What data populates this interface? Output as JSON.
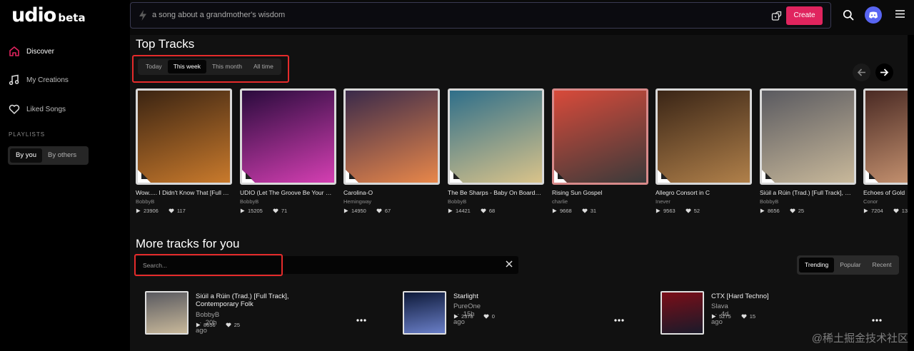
{
  "logo": {
    "main": "udio",
    "badge": "beta"
  },
  "sidebar": {
    "items": [
      {
        "label": "Discover",
        "icon": "home-icon",
        "active": true
      },
      {
        "label": "My Creations",
        "icon": "music-note-icon",
        "active": false
      },
      {
        "label": "Liked Songs",
        "icon": "heart-icon",
        "active": false
      }
    ],
    "playlists_label": "PLAYLISTS",
    "playlist_tabs": [
      {
        "label": "By you",
        "active": true
      },
      {
        "label": "By others",
        "active": false
      }
    ]
  },
  "topbar": {
    "prompt_placeholder": "a song about a grandmother's wisdom",
    "create_label": "Create",
    "icons": [
      "bolt-icon",
      "dice-icon",
      "search-icon",
      "discord-icon",
      "menu-icon"
    ]
  },
  "top_tracks": {
    "title": "Top Tracks",
    "tabs": [
      {
        "label": "Today",
        "active": false
      },
      {
        "label": "This week",
        "active": true
      },
      {
        "label": "This month",
        "active": false
      },
      {
        "label": "All time",
        "active": false
      }
    ],
    "tracks": [
      {
        "title": "Wow..... I Didn't Know That [Full Track]",
        "artist": "BobbyB",
        "plays": "23906",
        "likes": "117",
        "cover": [
          "#3b2412",
          "#c97a2c"
        ]
      },
      {
        "title": "UDIO (Let The Groove Be Your Guide)",
        "artist": "BobbyB",
        "plays": "15205",
        "likes": "71",
        "cover": [
          "#2a0b3d",
          "#d43fb2"
        ]
      },
      {
        "title": "Carolina-O",
        "artist": "Hemingway",
        "plays": "14950",
        "likes": "67",
        "cover": [
          "#3a2a4a",
          "#e8874a"
        ]
      },
      {
        "title": "The Be Sharps - Baby On Board, The Simpsons",
        "artist": "BobbyB",
        "plays": "14421",
        "likes": "68",
        "cover": [
          "#2f6f8a",
          "#d9c38a"
        ]
      },
      {
        "title": "Rising Sun Gospel",
        "artist": "charlie",
        "plays": "9668",
        "likes": "31",
        "cover": [
          "#d84a3a",
          "#3a3a3a"
        ]
      },
      {
        "title": "Allegro Consort in C",
        "artist": "Inever",
        "plays": "9563",
        "likes": "52",
        "cover": [
          "#3a2516",
          "#b0804a"
        ]
      },
      {
        "title": "Siúil a Rúin (Trad.) [Full Track], Contemporary Folk",
        "artist": "BobbyB",
        "plays": "8656",
        "likes": "25",
        "cover": [
          "#5a5a60",
          "#c8b89a"
        ]
      },
      {
        "title": "Echoes of Gold",
        "artist": "Conor",
        "plays": "7204",
        "likes": "13",
        "cover": [
          "#4a2a24",
          "#d6a07a"
        ]
      }
    ]
  },
  "more_tracks": {
    "title": "More tracks for you",
    "search_placeholder": "Search...",
    "sort_tabs": [
      {
        "label": "Trending",
        "active": true
      },
      {
        "label": "Popular",
        "active": false
      },
      {
        "label": "Recent",
        "active": false
      }
    ],
    "items": [
      {
        "title": "Siúil a Rúin (Trad.) [Full Track], Contemporary Folk",
        "artist": "BobbyB",
        "age": "20h ago",
        "plays": "8656",
        "likes": "25",
        "cover": [
          "#5a5a60",
          "#c8b89a"
        ]
      },
      {
        "title": "Starlight",
        "artist": "PureOne",
        "age": "15h ago",
        "plays": "2378",
        "likes": "0",
        "cover": [
          "#0e1a3a",
          "#6a7fc8"
        ]
      },
      {
        "title": "CTX [Hard Techno]",
        "artist": "Slava",
        "age": "4d ago",
        "plays": "5275",
        "likes": "15",
        "cover": [
          "#7a0e18",
          "#1a1a2a"
        ]
      }
    ]
  },
  "watermark": "@稀土掘金技术社区",
  "colors": {
    "accent": "#e0245e",
    "highlight": "#e52b2b",
    "discord": "#5865f2"
  }
}
